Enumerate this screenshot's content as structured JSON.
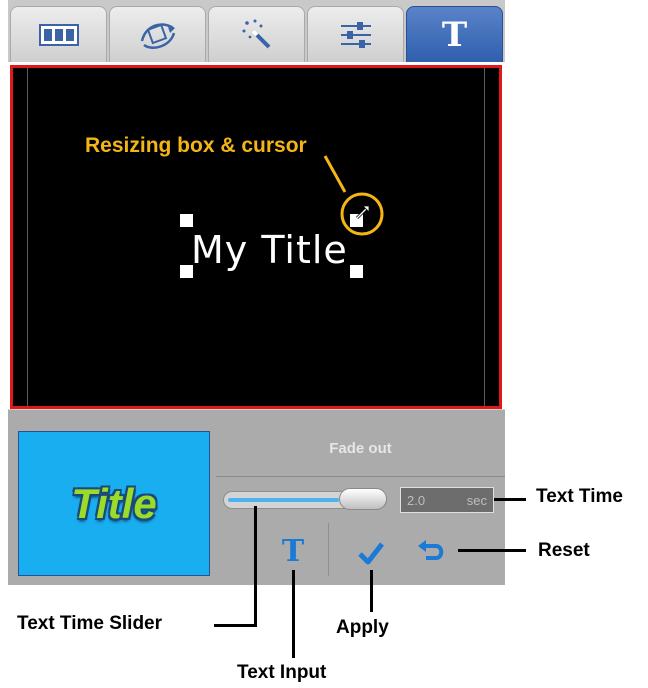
{
  "tabs": [
    {
      "name": "filmstrip-icon"
    },
    {
      "name": "transition-icon"
    },
    {
      "name": "magic-wand-icon"
    },
    {
      "name": "sliders-icon"
    },
    {
      "name": "text-icon",
      "label": "T",
      "active": true
    }
  ],
  "preview": {
    "title_text": "My Title",
    "callout": "Resizing box & cursor",
    "resize_cursor_icon": "resize-diagonal-icon"
  },
  "panel": {
    "thumbnail_text": "Title",
    "fade_label": "Fade out",
    "slider_fraction": 0.72,
    "time_value": "2.0",
    "time_unit": "sec",
    "text_input_label": "T",
    "apply_icon": "checkmark-icon",
    "reset_icon": "undo-icon"
  },
  "annotations": {
    "text_time": "Text Time",
    "reset": "Reset",
    "text_time_slider": "Text Time Slider",
    "apply": "Apply",
    "text_input": "Text Input"
  },
  "colors": {
    "accent_blue": "#2f5fae",
    "highlight_yellow": "#f4b616",
    "preview_border": "#e01818",
    "thumbnail_bg": "#19aef0"
  }
}
